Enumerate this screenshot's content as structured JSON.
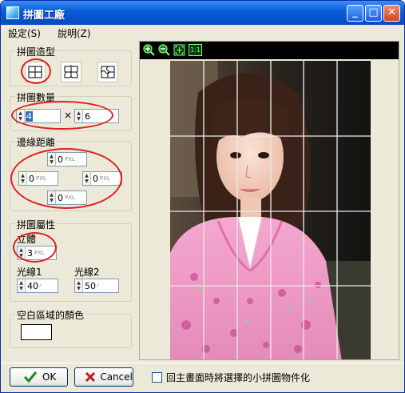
{
  "window": {
    "title": "拼圖工廠"
  },
  "title_buttons": {
    "minimize": "_",
    "maximize": "□",
    "close": "✕"
  },
  "menu": [
    {
      "label": "設定(S)"
    },
    {
      "label": "說明(Z)"
    }
  ],
  "shape_group": {
    "title": "拼圖造型",
    "options": [
      "grid-icon",
      "jigsaw-icon",
      "jigsaw-alt-icon"
    ]
  },
  "count_group": {
    "title": "拼圖數量",
    "rows": "4",
    "cols": "6",
    "times": "×"
  },
  "margin_group": {
    "title": "邊緣距離",
    "top": "0",
    "left": "0",
    "right": "0",
    "bottom": "0",
    "unit": "PXL"
  },
  "props_group": {
    "title": "拼圖屬性",
    "depth_label": "立體",
    "depth_value": "3",
    "depth_unit": "PXL",
    "light1_label": "光線1",
    "light1_value": "40",
    "light2_label": "光線2",
    "light2_value": "50",
    "light_unit": "⁄"
  },
  "blank_group": {
    "title": "空白區域的顏色",
    "color": "#ffffff"
  },
  "zoom_tools": [
    "zoom-in-icon",
    "zoom-out-icon",
    "fit-icon",
    "actual-size-icon"
  ],
  "zoom_labels": {
    "actual": "1:1"
  },
  "grid": {
    "rows": 4,
    "cols": 6
  },
  "buttons": {
    "ok": "OK",
    "cancel": "Cancel"
  },
  "checkbox": {
    "label": "回主畫面時將選擇的小拼圖物件化",
    "checked": false
  },
  "colors": {
    "title_bar": "#0a5fd8",
    "annotation": "#e02020",
    "dialog_bg": "#ece9d8"
  }
}
